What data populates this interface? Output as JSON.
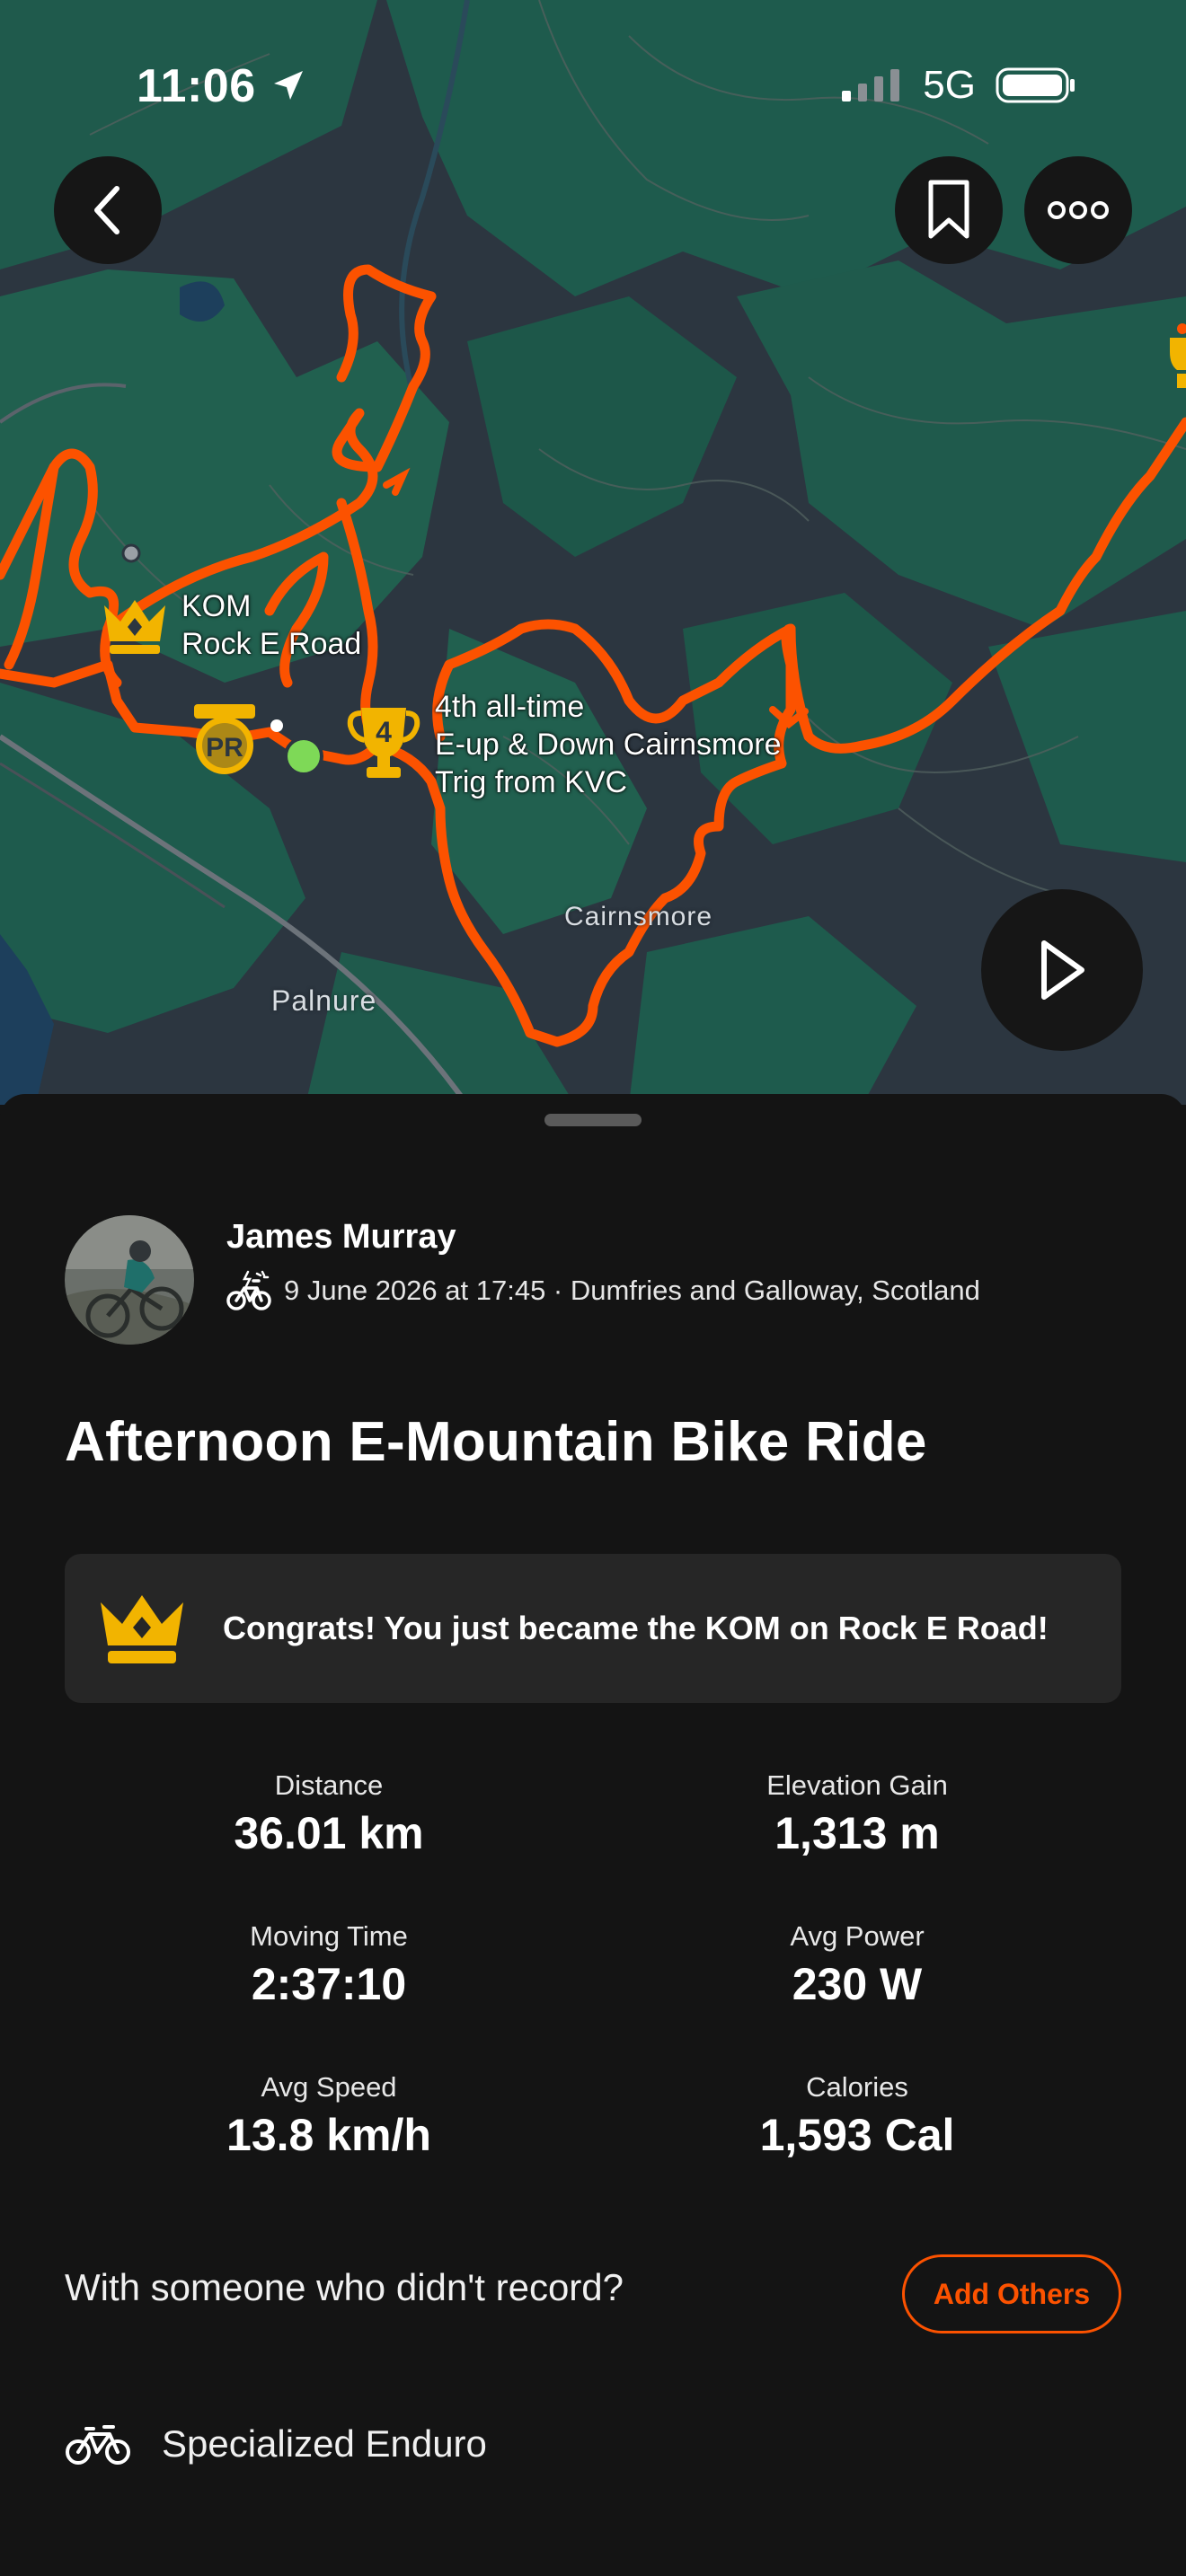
{
  "status_bar": {
    "time": "11:06",
    "network": "5G"
  },
  "map": {
    "kom_label_line1": "KOM",
    "kom_label_line2": "Rock E Road",
    "pr_badge": "PR",
    "trophy_rank": "4",
    "rank_label_line1": "4th all-time",
    "rank_label_line2": "E-up & Down Cairnsmore",
    "rank_label_line3": "Trig from KVC",
    "place_cairnsmore": "Cairnsmore",
    "place_palnure": "Palnure",
    "route_color": "#fc5200"
  },
  "athlete": {
    "name": "James Murray",
    "meta": "9 June 2026 at 17:45 · Dumfries and Galloway, Scotland"
  },
  "activity": {
    "title": "Afternoon E-Mountain Bike Ride"
  },
  "achievement": {
    "message": "Congrats! You just became the KOM on Rock E Road!"
  },
  "stats": {
    "distance_label": "Distance",
    "distance_value": "36.01 km",
    "elevation_label": "Elevation Gain",
    "elevation_value": "1,313 m",
    "moving_time_label": "Moving Time",
    "moving_time_value": "2:37:10",
    "avg_power_label": "Avg Power",
    "avg_power_value": "230 W",
    "avg_speed_label": "Avg Speed",
    "avg_speed_value": "13.8 km/h",
    "calories_label": "Calories",
    "calories_value": "1,593 Cal"
  },
  "group": {
    "prompt": "With someone who didn't record?",
    "button_label": "Add Others"
  },
  "gear": {
    "name": "Specialized Enduro"
  },
  "colors": {
    "accent": "#fc5200",
    "background": "#141414",
    "card": "#262626",
    "gold": "#f2b400"
  }
}
